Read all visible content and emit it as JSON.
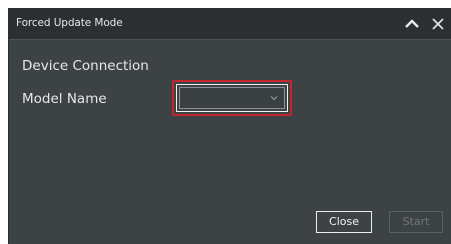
{
  "window": {
    "title": "Forced Update Mode"
  },
  "form": {
    "device_connection_label": "Device Connection",
    "model_name_label": "Model Name",
    "model_name_value": ""
  },
  "buttons": {
    "close_label": "Close",
    "start_label": "Start",
    "start_enabled": false
  },
  "icons": {
    "collapse": "chevron-up-icon",
    "close": "close-icon",
    "dropdown": "chevron-down-icon"
  },
  "colors": {
    "window_bg": "#3d4245",
    "titlebar_bg": "#2b2f31",
    "highlight": "#c1272d"
  }
}
